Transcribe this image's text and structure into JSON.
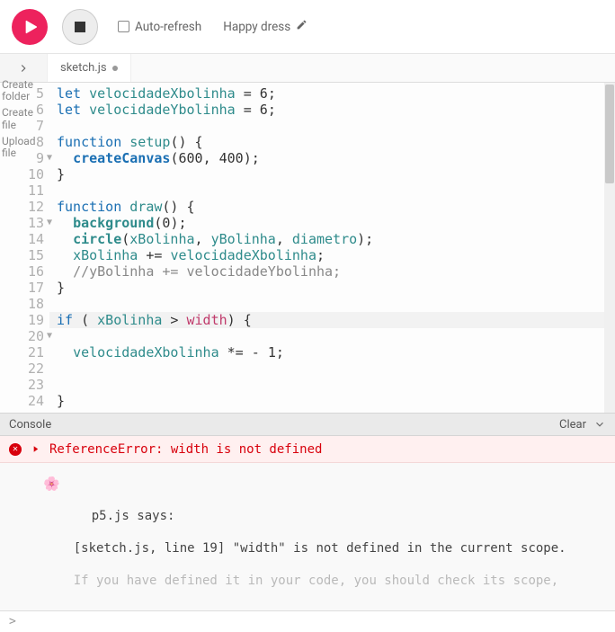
{
  "toolbar": {
    "auto_refresh_label": "Auto-refresh",
    "project_name": "Happy dress"
  },
  "sidebar": {
    "create_folder": "Create folder",
    "create_file": "Create file",
    "upload_file": "Upload file"
  },
  "tab": {
    "filename": "sketch.js"
  },
  "editor": {
    "first_line": 5,
    "lines": [
      {
        "n": 5,
        "html": "<span class='kw'>let</span> <span class='var'>velocidadeXbolinha</span> <span class='op'>=</span> <span class='num'>6</span>;"
      },
      {
        "n": 6,
        "html": "<span class='kw'>let</span> <span class='var'>velocidadeYbolinha</span> <span class='op'>=</span> <span class='num'>6</span>;"
      },
      {
        "n": 7,
        "html": ""
      },
      {
        "n": 8,
        "fold": true,
        "html": "<span class='kw'>function</span> <span class='kw2'>setup</span>() {"
      },
      {
        "n": 9,
        "html": "  <span class='fn2'>createCanvas</span>(<span class='num'>600</span>, <span class='num'>400</span>);"
      },
      {
        "n": 10,
        "html": "}"
      },
      {
        "n": 11,
        "html": ""
      },
      {
        "n": 12,
        "fold": true,
        "html": "<span class='kw'>function</span> <span class='kw2'>draw</span>() {"
      },
      {
        "n": 13,
        "html": "  <span class='fnb'>background</span>(<span class='num'>0</span>);"
      },
      {
        "n": 14,
        "html": "  <span class='fnb'>circle</span>(<span class='var'>xBolinha</span>, <span class='var'>yBolinha</span>, <span class='var'>diametro</span>);"
      },
      {
        "n": 15,
        "html": "  <span class='var'>xBolinha</span> += <span class='var'>velocidadeXbolinha</span>;"
      },
      {
        "n": 16,
        "html": "  <span class='cmt'>//yBolinha += velocidadeYbolinha;</span>"
      },
      {
        "n": 17,
        "html": "}"
      },
      {
        "n": 18,
        "html": ""
      },
      {
        "n": 19,
        "fold": true,
        "hl": true,
        "html": "<span class='kw'>if</span> ( <span class='var'>xBolinha</span> > <span class='kw3'>width</span>) {"
      },
      {
        "n": 20,
        "html": ""
      },
      {
        "n": 21,
        "html": "  <span class='var'>velocidadeXbolinha</span> *= - <span class='num'>1</span>;"
      },
      {
        "n": 22,
        "html": ""
      },
      {
        "n": 23,
        "html": ""
      },
      {
        "n": 24,
        "html": "}"
      }
    ]
  },
  "console": {
    "header": "Console",
    "clear": "Clear",
    "error_text": "ReferenceError: width is not defined",
    "p5_says": "p5.js says:",
    "p5_detail": "[sketch.js, line 19] \"width\" is not defined in the current scope.",
    "p5_detail2": "If you have defined it in your code, you should check its scope,",
    "prompt": ">"
  }
}
